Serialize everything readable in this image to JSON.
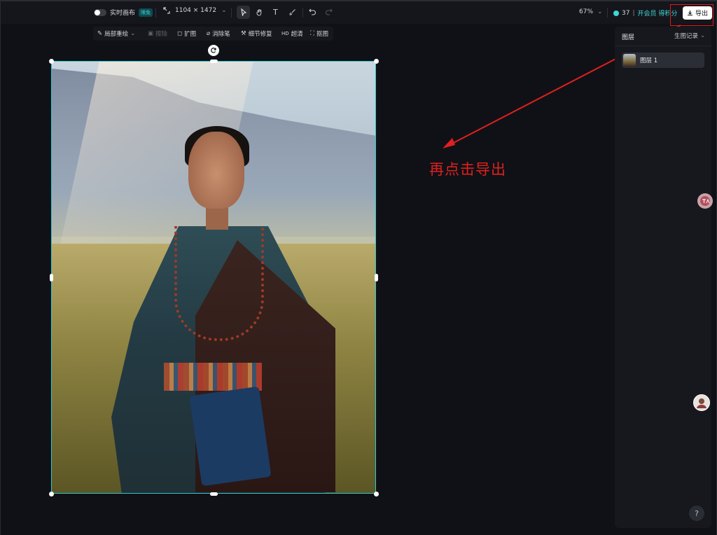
{
  "toolbar": {
    "live_canvas_label": "实时画布",
    "live_canvas_badge": "限免",
    "canvas_size": "1104 × 1472",
    "zoom": "67%",
    "credits": "37",
    "membership_link": "开会员 得积分",
    "export_label": "导出"
  },
  "subtoolbar": {
    "items": [
      "局部重绘",
      "擦除",
      "扩图",
      "消除笔",
      "细节修复",
      "超清",
      "抠图"
    ],
    "hd_prefix": "HD"
  },
  "panel": {
    "layers_title": "图层",
    "history_label": "生图记录",
    "layer_name": "图层 1"
  },
  "annotation": {
    "text": "再点击导出",
    "color": "#e0201f"
  },
  "colors": {
    "selection": "#2ec9cf",
    "badge": "#3ed6d6",
    "background": "#101116"
  },
  "help_label": "?"
}
